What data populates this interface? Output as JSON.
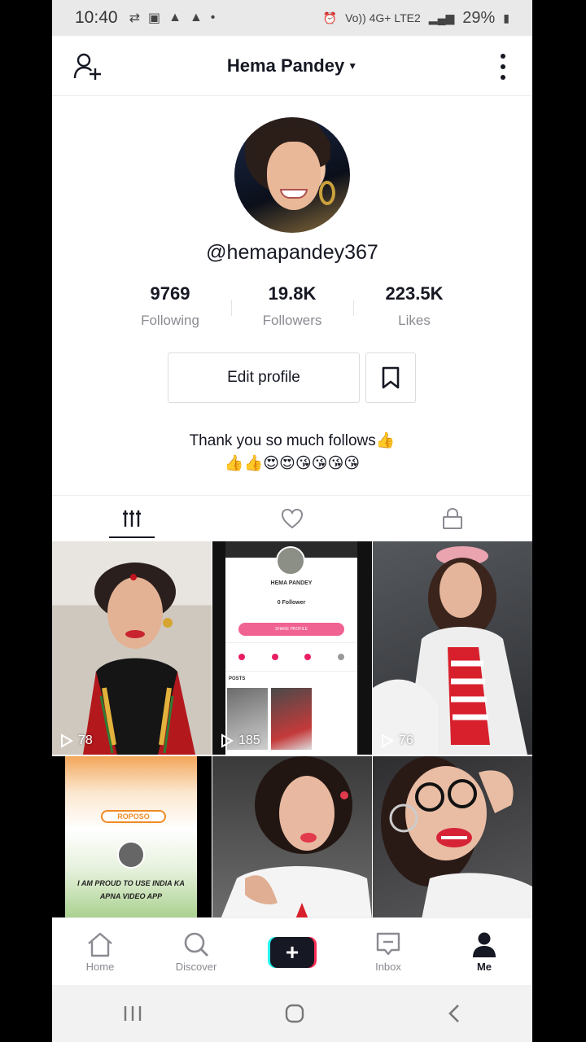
{
  "status_bar": {
    "time": "10:40",
    "network": "Vo)) 4G+ LTE2",
    "battery": "29%"
  },
  "header": {
    "title": "Hema Pandey"
  },
  "profile": {
    "username": "@hemapandey367",
    "stats": [
      {
        "value": "9769",
        "label": "Following"
      },
      {
        "value": "19.8K",
        "label": "Followers"
      },
      {
        "value": "223.5K",
        "label": "Likes"
      }
    ],
    "edit_label": "Edit profile",
    "bio_line1": "Thank you so much follows👍",
    "bio_line2": "👍👍😍😍😘😘😘😘"
  },
  "tabs": [
    {
      "icon": "grid-icon",
      "active": true
    },
    {
      "icon": "heart-icon",
      "active": false
    },
    {
      "icon": "lock-icon",
      "active": false
    }
  ],
  "videos": [
    {
      "views": "78"
    },
    {
      "views": "185",
      "inner_name": "HEMA PANDEY",
      "inner_follower": "0 Follower",
      "inner_button": "SHARE PROFILE",
      "inner_posts": "POSTS"
    },
    {
      "views": "76"
    },
    {
      "caption": "I AM PROUD TO USE INDIA KA APNA VIDEO APP",
      "brand": "ROPOSO"
    },
    {},
    {}
  ],
  "bottom_nav": [
    {
      "label": "Home",
      "icon": "home-icon"
    },
    {
      "label": "Discover",
      "icon": "search-icon"
    },
    {
      "label": "",
      "icon": "plus-icon"
    },
    {
      "label": "Inbox",
      "icon": "inbox-icon"
    },
    {
      "label": "Me",
      "icon": "person-icon"
    }
  ],
  "colors": {
    "accent_pink": "#fe2c55",
    "accent_cyan": "#25f4ee",
    "text_primary": "#161823",
    "text_secondary": "#8a8b91"
  }
}
